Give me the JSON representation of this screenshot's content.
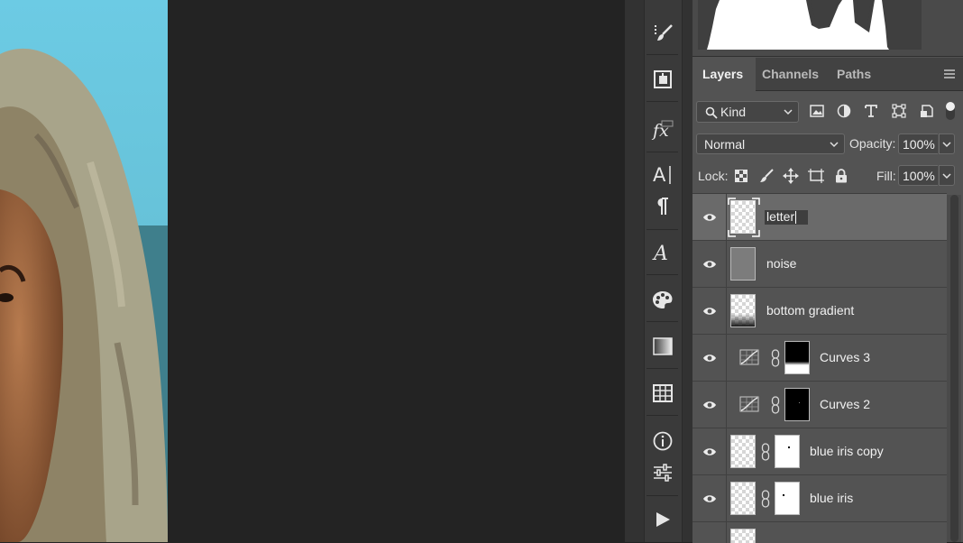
{
  "panels": {
    "tabs": [
      {
        "label": "Layers",
        "active": true
      },
      {
        "label": "Channels",
        "active": false
      },
      {
        "label": "Paths",
        "active": false
      }
    ]
  },
  "filter": {
    "kind_label": "Kind",
    "icons": [
      "image-filter-icon",
      "adjustment-filter-icon",
      "type-filter-icon",
      "shape-filter-icon",
      "smart-object-filter-icon",
      "filter-toggle-icon"
    ]
  },
  "blend": {
    "mode": "Normal",
    "opacity_label": "Opacity:",
    "opacity_value": "100%"
  },
  "lock": {
    "label": "Lock:",
    "fill_label": "Fill:",
    "fill_value": "100%"
  },
  "layers": [
    {
      "name": "letter",
      "type": "pixel",
      "thumb": "checker",
      "selected": true,
      "editing": true
    },
    {
      "name": "noise",
      "type": "pixel",
      "thumb": "gray",
      "selected": false
    },
    {
      "name": "bottom gradient",
      "type": "pixel",
      "thumb": "gradient",
      "selected": false
    },
    {
      "name": "Curves 3",
      "type": "curves",
      "mask": "black-white-bottom",
      "selected": false
    },
    {
      "name": "Curves 2",
      "type": "curves",
      "mask": "black",
      "selected": false
    },
    {
      "name": "blue iris copy",
      "type": "masked",
      "mask": "white-dot",
      "selected": false
    },
    {
      "name": "blue iris",
      "type": "masked",
      "mask": "white-dot",
      "selected": false
    }
  ],
  "tools": [
    "brush-presets-icon",
    "clone-source-icon",
    "fx-styles-icon",
    "character-icon",
    "paragraph-icon",
    "glyphs-icon",
    "swatches-icon",
    "gradients-icon",
    "patterns-icon",
    "info-icon",
    "adjustments-icon",
    "actions-play-icon"
  ],
  "colors": {
    "accent_sky": "#6cc4dc",
    "panel_bg": "#535353",
    "selected_row": "#6a6a6a",
    "canvas_bg": "#232323"
  }
}
